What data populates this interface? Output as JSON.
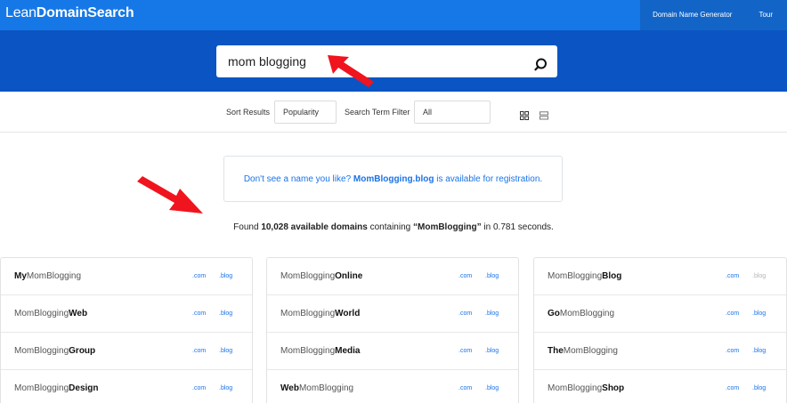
{
  "logo": {
    "part1": "Lean",
    "part2": "DomainSearch"
  },
  "nav": {
    "generator": "Domain Name Generator",
    "tour": "Tour"
  },
  "search": {
    "value": "mom blogging"
  },
  "filters": {
    "sort_label": "Sort Results",
    "sort_value": "Popularity",
    "term_label": "Search Term Filter",
    "term_value": "All"
  },
  "message": {
    "prefix": "Don't see a name you like? ",
    "domain": "MomBlogging.blog",
    "suffix": " is available for registration."
  },
  "found": {
    "prefix": "Found ",
    "count": "10,028",
    "count_label": " available domains",
    "middle": " containing ",
    "term": "“MomBlogging”",
    "suffix": " in 0.781 seconds."
  },
  "tlds": {
    "com": ".com",
    "blog": ".blog"
  },
  "accent_colors": {
    "nav": "#1678e6",
    "search_band": "#0a55c3",
    "link": "#1a73e8",
    "arrow": "#f0141e"
  },
  "columns": [
    [
      {
        "pre": "",
        "bold": "My",
        "post": "MomBlogging",
        "blog_dim": false
      },
      {
        "pre": "MomBlogging",
        "bold": "Web",
        "post": "",
        "blog_dim": false
      },
      {
        "pre": "MomBlogging",
        "bold": "Group",
        "post": "",
        "blog_dim": false
      },
      {
        "pre": "MomBlogging",
        "bold": "Design",
        "post": "",
        "blog_dim": false
      }
    ],
    [
      {
        "pre": "MomBlogging",
        "bold": "Online",
        "post": "",
        "blog_dim": false
      },
      {
        "pre": "MomBlogging",
        "bold": "World",
        "post": "",
        "blog_dim": false
      },
      {
        "pre": "MomBlogging",
        "bold": "Media",
        "post": "",
        "blog_dim": false
      },
      {
        "pre": "",
        "bold": "Web",
        "post": "MomBlogging",
        "blog_dim": false
      }
    ],
    [
      {
        "pre": "MomBlogging",
        "bold": "Blog",
        "post": "",
        "blog_dim": true
      },
      {
        "pre": "",
        "bold": "Go",
        "post": "MomBlogging",
        "blog_dim": false
      },
      {
        "pre": "",
        "bold": "The",
        "post": "MomBlogging",
        "blog_dim": false
      },
      {
        "pre": "MomBlogging",
        "bold": "Shop",
        "post": "",
        "blog_dim": false
      }
    ]
  ]
}
